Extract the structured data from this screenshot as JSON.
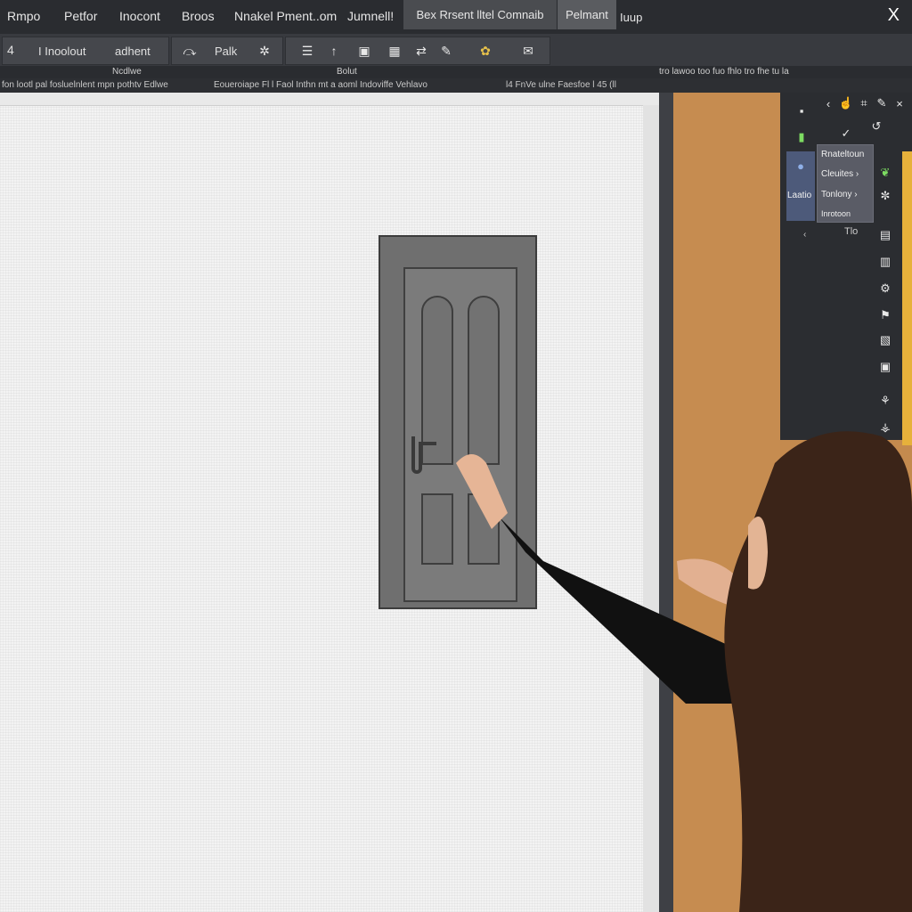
{
  "menu": {
    "items": [
      "Rmpo",
      "Petfor",
      "Inocont",
      "Broos",
      "Nnakel Pment..om",
      "Jumnell!"
    ],
    "tab_active": "Bex Rrsent lltel Comnaib",
    "tab_second": "Pelmant",
    "after_tab": "Iuup",
    "close": "X"
  },
  "toolbar": {
    "number": "4",
    "label_1": "I Inoolout",
    "label_2": "adhent",
    "label_3": "Palk"
  },
  "second_row": {
    "left_label": "Ncdlwe",
    "mid_label": "Bolut",
    "right_label": "tro lawoo too fuo fhlo tro fhe tu la"
  },
  "status_strip": {
    "text_1": "fon lootl pal fosluelnlent mpn pothtv Edlwe",
    "text_2": "Eoueroiape Fl l  Faol  Inthn mt  a  aoml Indoviffe Vehlavo",
    "text_3": "l4  FnVe  ulne  Faesfoe l 45 (ll"
  },
  "right_panel": {
    "flyout_items": [
      "Rnateltoun",
      "Cleuites ›",
      "Tonlony ›",
      "Inrotoon"
    ],
    "side_label": "Laatio",
    "below_label": "Tlo"
  },
  "colors": {
    "menubar": "#2a2c30",
    "toolbar": "#383a3f",
    "canvas": "#f3f3f3",
    "door": "#7b7b7b",
    "wood_panel": "#c68c50",
    "accent_yellow": "#e7b13b"
  },
  "icons": {
    "toolbar": [
      "cursor-icon",
      "list-icon",
      "arrow-up-icon",
      "image-icon",
      "frame-icon",
      "arrows-icon",
      "marker-icon",
      "palette-icon",
      "chat-icon"
    ],
    "side": [
      "square-icon",
      "arrow-icon",
      "undo-icon",
      "check-icon",
      "grid-icon",
      "doc-icon",
      "gear-icon",
      "flag-icon",
      "page-icon",
      "box-icon",
      "leaf-icon",
      "tree-icon"
    ]
  }
}
